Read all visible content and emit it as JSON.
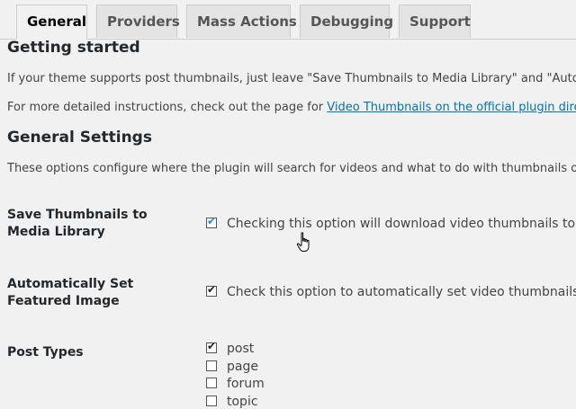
{
  "tabs": [
    {
      "label": "General"
    },
    {
      "label": "Providers"
    },
    {
      "label": "Mass Actions"
    },
    {
      "label": "Debugging"
    },
    {
      "label": "Support"
    }
  ],
  "getting_started": {
    "heading": "Getting started",
    "para1": "If your theme supports post thumbnails, just leave \"Save Thumbnails to Media Library\" and \"Automatically Set Featured Image\" checked",
    "para2_prefix": "For more detailed instructions, check out the page for ",
    "para2_link": "Video Thumbnails on the official plugin directory",
    "para2_suffix": "."
  },
  "general_settings": {
    "heading": "General Settings",
    "intro": "These options configure where the plugin will search for videos and what to do with thumbnails once found."
  },
  "settings": {
    "save_thumbnails": {
      "label": "Save Thumbnails to Media Library",
      "checked": true,
      "description": "Checking this option will download video thumbnails to your server"
    },
    "set_featured": {
      "label": "Automatically Set Featured Image",
      "checked": true,
      "description": "Check this option to automatically set video thumbnails as the featured image"
    },
    "post_types": {
      "label": "Post Types",
      "options": [
        {
          "label": "post",
          "checked": true
        },
        {
          "label": "page",
          "checked": false
        },
        {
          "label": "forum",
          "checked": false
        },
        {
          "label": "topic",
          "checked": false
        }
      ]
    }
  },
  "colors": {
    "accent": "#1e8cbe",
    "link": "#0073aa",
    "background": "#f1f1f1"
  }
}
